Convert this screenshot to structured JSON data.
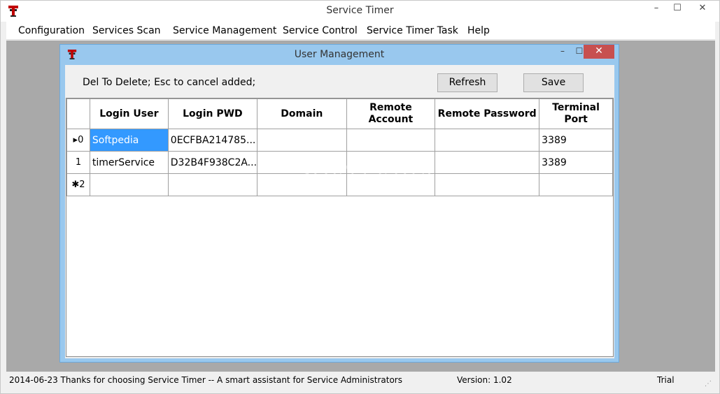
{
  "app": {
    "title": "Service Timer",
    "window_controls": {
      "minimize": "–",
      "maximize": "☐",
      "close": "✕"
    }
  },
  "menu": {
    "items": [
      {
        "label": "Configuration"
      },
      {
        "label": "Services Scan"
      },
      {
        "label": "Service Management"
      },
      {
        "label": "Service Control"
      },
      {
        "label": "Service Timer Task"
      },
      {
        "label": "Help"
      }
    ]
  },
  "watermark": "SOFTPEDIA",
  "dialog": {
    "title": "User Management",
    "controls": {
      "minimize": "–",
      "maximize": "☐",
      "close": "✕"
    },
    "hint": "Del To Delete; Esc to cancel added;",
    "refresh_label": "Refresh",
    "save_label": "Save",
    "grid": {
      "columns": [
        {
          "label": "Login User"
        },
        {
          "label": "Login PWD"
        },
        {
          "label": "Domain"
        },
        {
          "label": "Remote Account"
        },
        {
          "label": "Remote Password"
        },
        {
          "label": "Terminal Port"
        }
      ],
      "rows": [
        {
          "header": "▸0",
          "cells": [
            "Softpedia",
            "0ECFBA214785...",
            "",
            "",
            "",
            "3389"
          ]
        },
        {
          "header": "1",
          "cells": [
            "timerService",
            "D32B4F938C2A...",
            "",
            "",
            "",
            "3389"
          ]
        },
        {
          "header": "✱2",
          "cells": [
            "",
            "",
            "",
            "",
            "",
            ""
          ]
        }
      ]
    }
  },
  "status": {
    "message": "2014-06-23  Thanks for choosing Service Timer -- A smart assistant for Service Administrators",
    "version": "Version: 1.02",
    "license": "Trial",
    "grip": "⋰"
  },
  "colors": {
    "selection": "#3399ff",
    "dialog_frame": "#99c8ee",
    "close_button": "#c75050",
    "workspace": "#a9a9a9"
  }
}
